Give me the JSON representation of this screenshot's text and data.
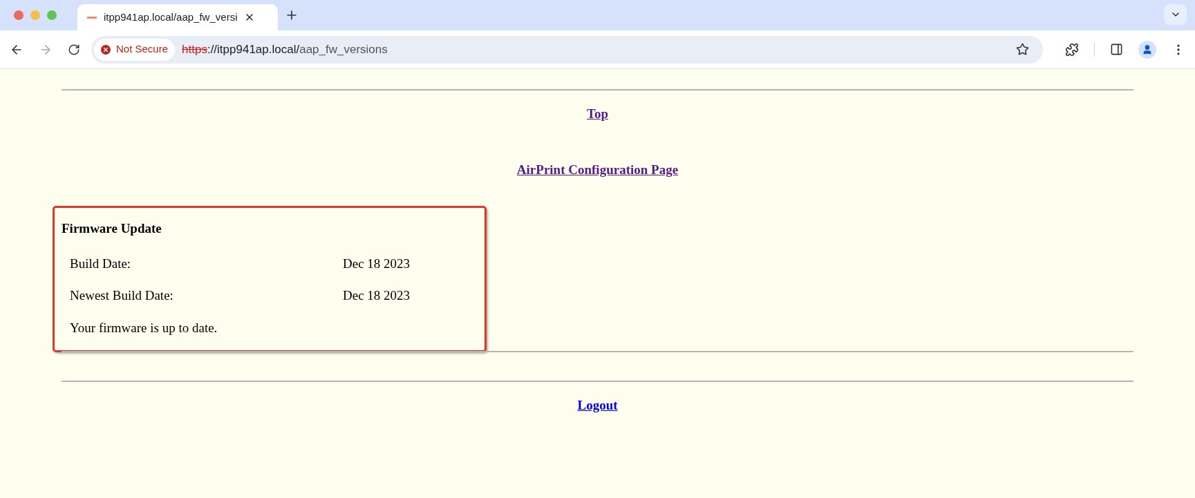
{
  "browser": {
    "tab": {
      "title": "itpp941ap.local/aap_fw_versi",
      "selected": true
    },
    "security": {
      "label": "Not Secure"
    },
    "url": {
      "scheme": "https",
      "host": "://itpp941ap.local/",
      "path": "aap_fw_versions"
    }
  },
  "page": {
    "links": [
      {
        "label": "Top",
        "visited": true
      },
      {
        "label": "AirPrint Configuration Page",
        "visited": true
      }
    ],
    "panel": {
      "title": "Firmware Update",
      "rows": [
        {
          "label": "Build Date:",
          "value": "Dec 18 2023"
        },
        {
          "label": "Newest Build Date:",
          "value": "Dec 18 2023"
        }
      ],
      "status": "Your firmware is up to date."
    },
    "footer_link": {
      "label": "Logout",
      "visited": false
    }
  }
}
